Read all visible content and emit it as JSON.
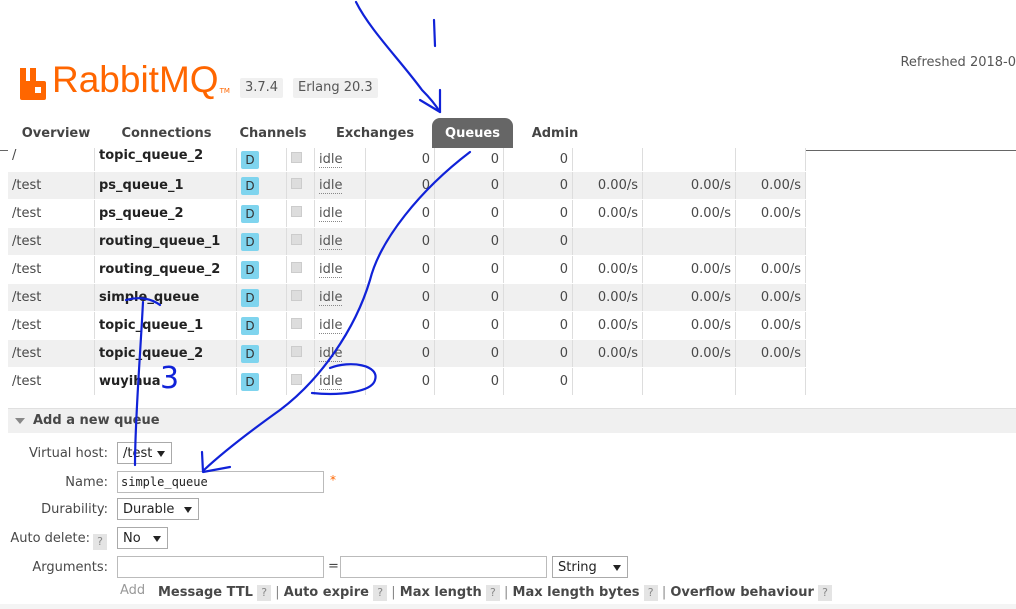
{
  "header": {
    "brand": "RabbitMQ",
    "brand_tm": "TM",
    "version": "3.7.4",
    "erlang": "Erlang 20.3",
    "refreshed": "Refreshed 2018-0"
  },
  "tabs": [
    {
      "label": "Overview"
    },
    {
      "label": "Connections"
    },
    {
      "label": "Channels"
    },
    {
      "label": "Exchanges"
    },
    {
      "label": "Queues",
      "active": true
    },
    {
      "label": "Admin"
    }
  ],
  "queues": [
    {
      "vhost": "/",
      "name": "topic_queue_2",
      "features": "D",
      "state": "idle",
      "ready": "0",
      "unacked": "0",
      "total": "0",
      "incoming": "",
      "deliver": "",
      "ack": ""
    },
    {
      "vhost": "/test",
      "name": "ps_queue_1",
      "features": "D",
      "state": "idle",
      "ready": "0",
      "unacked": "0",
      "total": "0",
      "incoming": "0.00/s",
      "deliver": "0.00/s",
      "ack": "0.00/s"
    },
    {
      "vhost": "/test",
      "name": "ps_queue_2",
      "features": "D",
      "state": "idle",
      "ready": "0",
      "unacked": "0",
      "total": "0",
      "incoming": "0.00/s",
      "deliver": "0.00/s",
      "ack": "0.00/s"
    },
    {
      "vhost": "/test",
      "name": "routing_queue_1",
      "features": "D",
      "state": "idle",
      "ready": "0",
      "unacked": "0",
      "total": "0",
      "incoming": "",
      "deliver": "",
      "ack": ""
    },
    {
      "vhost": "/test",
      "name": "routing_queue_2",
      "features": "D",
      "state": "idle",
      "ready": "0",
      "unacked": "0",
      "total": "0",
      "incoming": "0.00/s",
      "deliver": "0.00/s",
      "ack": "0.00/s"
    },
    {
      "vhost": "/test",
      "name": "simple_queue",
      "features": "D",
      "state": "idle",
      "ready": "0",
      "unacked": "0",
      "total": "0",
      "incoming": "0.00/s",
      "deliver": "0.00/s",
      "ack": "0.00/s"
    },
    {
      "vhost": "/test",
      "name": "topic_queue_1",
      "features": "D",
      "state": "idle",
      "ready": "0",
      "unacked": "0",
      "total": "0",
      "incoming": "0.00/s",
      "deliver": "0.00/s",
      "ack": "0.00/s"
    },
    {
      "vhost": "/test",
      "name": "topic_queue_2",
      "features": "D",
      "state": "idle",
      "ready": "0",
      "unacked": "0",
      "total": "0",
      "incoming": "0.00/s",
      "deliver": "0.00/s",
      "ack": "0.00/s"
    },
    {
      "vhost": "/test",
      "name": "wuyihua",
      "features": "D",
      "state": "idle",
      "ready": "0",
      "unacked": "0",
      "total": "0",
      "incoming": "",
      "deliver": "",
      "ack": ""
    }
  ],
  "add_queue": {
    "title": "Add a new queue",
    "vhost_label": "Virtual host:",
    "vhost_value": "/test",
    "name_label": "Name:",
    "name_value": "simple_queue",
    "required_mark": "*",
    "durability_label": "Durability:",
    "durability_value": "Durable",
    "autodelete_label": "Auto delete:",
    "autodelete_value": "No",
    "arguments_label": "Arguments:",
    "equals": "=",
    "arg_type": "String",
    "add_label": "Add",
    "help": "?",
    "arg_shortcuts": [
      "Message TTL",
      "Auto expire",
      "Max length",
      "Max length bytes",
      "Overflow behaviour"
    ],
    "separator": "|"
  },
  "annotations": {
    "number_mark": "3",
    "ink_color": "#1022d8"
  },
  "colors": {
    "brand_orange": "#ff6600",
    "active_tab": "#666666",
    "feature_badge": "#7fd4ee"
  }
}
